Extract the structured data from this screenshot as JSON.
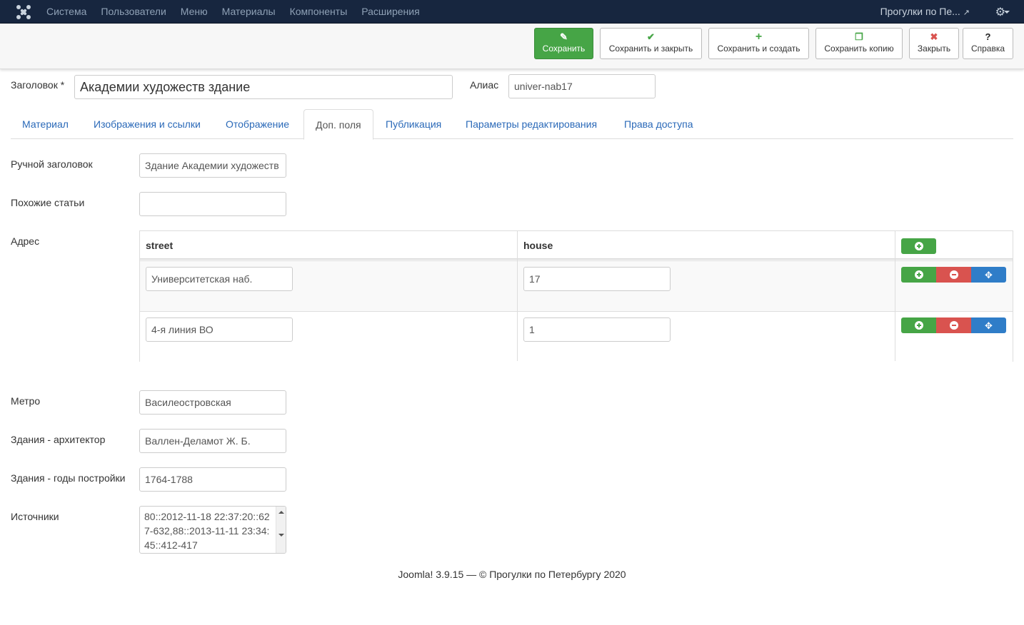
{
  "topnav": {
    "menu": [
      "Система",
      "Пользователи",
      "Меню",
      "Материалы",
      "Компоненты",
      "Расширения"
    ],
    "site_name": "Прогулки по Пе..."
  },
  "toolbar": {
    "save": "Сохранить",
    "save_close": "Сохранить и закрыть",
    "save_new": "Сохранить и создать",
    "save_copy": "Сохранить копию",
    "close": "Закрыть",
    "help": "Справка"
  },
  "title_row": {
    "title_label": "Заголовок *",
    "title_value": "Академии художеств здание",
    "alias_label": "Алиас",
    "alias_value": "univer-nab17"
  },
  "tabs": [
    "Материал",
    "Изображения и ссылки",
    "Отображение",
    "Доп. поля",
    "Публикация",
    "Параметры редактирования",
    "Права доступа"
  ],
  "fields": {
    "manual_title_label": "Ручной заголовок",
    "manual_title_value": "Здание Академии художеств",
    "related_label": "Похожие статьи",
    "related_value": "",
    "address_label": "Адрес",
    "metro_label": "Метро",
    "metro_value": "Василеостровская",
    "architect_label": "Здания - архитектор",
    "architect_value": "Валлен-Деламот Ж. Б.",
    "years_label": "Здания - годы постройки",
    "years_value": "1764-1788",
    "sources_label": "Источники",
    "sources_value": "80::2012-11-18 22:37:20::627-632,88::2013-11-11 23:34:45::412-417"
  },
  "address_table": {
    "col_street": "street",
    "col_house": "house",
    "rows": [
      {
        "street": "Университетская наб.",
        "house": "17"
      },
      {
        "street": "4-я линия ВО",
        "house": "1"
      }
    ]
  },
  "footer": "Joomla! 3.9.15  —  © Прогулки по Петербургу 2020",
  "colors": {
    "nav_bg": "#17263f",
    "success": "#46a546",
    "danger": "#d9534f",
    "primary": "#2f7dc8",
    "link": "#2a69b8"
  }
}
